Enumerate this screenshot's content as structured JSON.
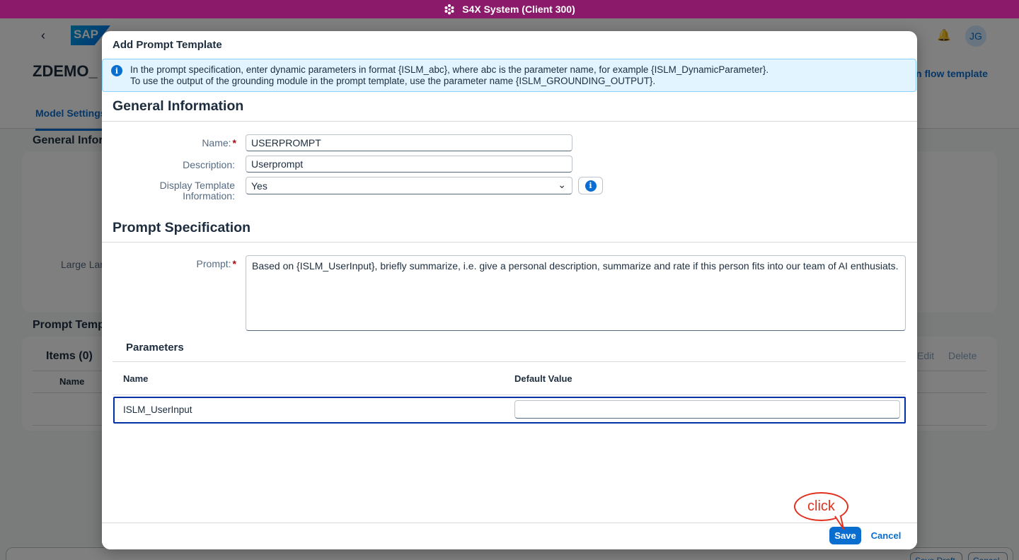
{
  "system_bar": {
    "title": "S4X System (Client 300)",
    "icon": "cube-icon"
  },
  "background": {
    "page_title": "ZDEMO_",
    "logo_text": "SAP",
    "avatar_initials": "JG",
    "header_link": "n flow template",
    "tab_label": "Model Settings",
    "section_general": "General Inform",
    "field_large": "Large Lan",
    "section_prompt": "Prompt Temp",
    "items_title": "Items (0)",
    "column_name": "Name",
    "edit_label": "Edit",
    "delete_label": "Delete",
    "save_draft_label": "Save Draft",
    "cancel_label": "Cancel"
  },
  "dialog": {
    "title": "Add Prompt Template",
    "info_strip": {
      "line1": "In the prompt specification, enter dynamic parameters in format {ISLM_abc}, where abc is the parameter name, for example {ISLM_DynamicParameter}.",
      "line2": "To use the output of the grounding module in the prompt template, use the parameter name {ISLM_GROUNDING_OUTPUT}."
    },
    "general_info": {
      "title": "General Information",
      "name_label": "Name:",
      "name_value": "USERPROMPT",
      "description_label": "Description:",
      "description_value": "Userprompt",
      "display_label_line1": "Display Template",
      "display_label_line2": "Information:",
      "display_value": "Yes"
    },
    "prompt_spec": {
      "title": "Prompt Specification",
      "prompt_label": "Prompt:",
      "prompt_value": "Based on {ISLM_UserInput}, briefly summarize, i.e. give a personal description, summarize and rate if this person fits into our team of AI enthusiats."
    },
    "parameters": {
      "title": "Parameters",
      "columns": [
        "Name",
        "Default Value"
      ],
      "rows": [
        {
          "name": "ISLM_UserInput",
          "default_value": ""
        }
      ]
    },
    "footer": {
      "save_label": "Save",
      "cancel_label": "Cancel"
    }
  },
  "annotation": {
    "callout_text": "click",
    "color": "#e0301e"
  },
  "colors": {
    "system_bar": "#8b1a6b",
    "accent": "#0a6ed1",
    "info_strip": "#e1f4ff",
    "selected_row_border": "#0032a5"
  }
}
